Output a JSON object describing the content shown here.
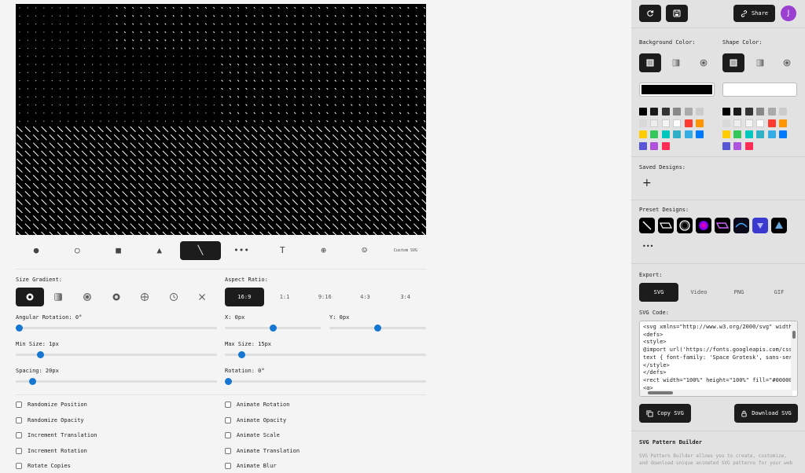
{
  "shape_bar": {
    "items": [
      {
        "icon": "circle-filled-icon",
        "glyph": "●"
      },
      {
        "icon": "circle-outline-icon",
        "glyph": "○"
      },
      {
        "icon": "square-icon",
        "glyph": "■"
      },
      {
        "icon": "triangle-icon",
        "glyph": "▲"
      },
      {
        "icon": "line-icon",
        "glyph": "╲",
        "active": true
      },
      {
        "icon": "dots-icon",
        "glyph": "•••"
      },
      {
        "icon": "text-icon",
        "glyph": "T"
      },
      {
        "icon": "arrow-circle-icon",
        "glyph": "⊕"
      },
      {
        "icon": "smiley-icon",
        "glyph": "☺"
      },
      {
        "icon": "custom-svg-icon",
        "label": "Custom SVG"
      }
    ]
  },
  "size_gradient": {
    "label": "Size Gradient:",
    "items": [
      {
        "icon": "radial-center-icon",
        "active": true
      },
      {
        "icon": "linear-gradient-icon"
      },
      {
        "icon": "ring-icon"
      },
      {
        "icon": "target-icon"
      },
      {
        "icon": "crosshair-icon"
      },
      {
        "icon": "clock-icon"
      },
      {
        "icon": "x-icon"
      }
    ]
  },
  "aspect_ratio": {
    "label": "Aspect Ratio:",
    "options": [
      "16:9",
      "1:1",
      "9:16",
      "4:3",
      "3:4"
    ],
    "selected": "16:9"
  },
  "sliders": {
    "angular_rotation": {
      "label": "Angular Rotation: 0°",
      "value": 0,
      "max": 360
    },
    "x": {
      "label": "X: 0px",
      "value": 0.5
    },
    "y": {
      "label": "Y: 0px",
      "value": 0.5
    },
    "min_size": {
      "label": "Min Size: 1px",
      "value": 0.11
    },
    "max_size": {
      "label": "Max Size: 15px",
      "value": 0.07
    },
    "spacing": {
      "label": "Spacing: 20px",
      "value": 0.07
    },
    "rotation": {
      "label": "Rotation: 0°",
      "value": 0
    }
  },
  "checkboxes_left": [
    "Randomize Position",
    "Randomize Opacity",
    "Increment Translation",
    "Increment Rotation",
    "Rotate Copies"
  ],
  "checkboxes_right": [
    "Animate Rotation",
    "Animate Opacity",
    "Animate Scale",
    "Animate Translation",
    "Animate Blur"
  ],
  "sidebar": {
    "share_label": "Share",
    "avatar_initial": "J",
    "background_color_label": "Background Color:",
    "shape_color_label": "Shape Color:",
    "background_color": "#000000",
    "shape_color": "#ffffff",
    "swatches": [
      "#000000",
      "#1a1a1a",
      "#333333",
      "#888888",
      "#aaaaaa",
      "#cccccc",
      "#d9d9d9",
      "#eeeeee",
      "#f5f5f5",
      "#ffffff",
      "#ff3b30",
      "#ff9500",
      "#ffcc00",
      "#34c759",
      "#00c7be",
      "#30b0c7",
      "#32ade6",
      "#007aff",
      "#5856d6",
      "#af52de",
      "#ff2d55"
    ],
    "saved_designs_label": "Saved Designs:",
    "add_glyph": "+",
    "preset_designs_label": "Preset Designs:",
    "more_glyph": "•••",
    "export_label": "Export:",
    "export_tabs": [
      "SVG",
      "Video",
      "PNG",
      "GIF"
    ],
    "export_selected": "SVG",
    "svg_code_label": "SVG Code:",
    "svg_code": "<svg xmlns=\"http://www.w3.org/2000/svg\" width=\"\n<defs>\n<style>\n@import url('https://fonts.googleapis.com/css2?\ntext { font-family: 'Space Grotesk', sans-serif\n</style>\n</defs>\n<rect width=\"100%\" height=\"100%\" fill=\"#000000\"\n<g>",
    "copy_label": "Copy SVG",
    "download_label": "Download SVG",
    "about_title": "SVG Pattern Builder",
    "about_text": "SVG Pattern Builder allows you to create, customize, and download unique animated SVG patterns for your web"
  }
}
